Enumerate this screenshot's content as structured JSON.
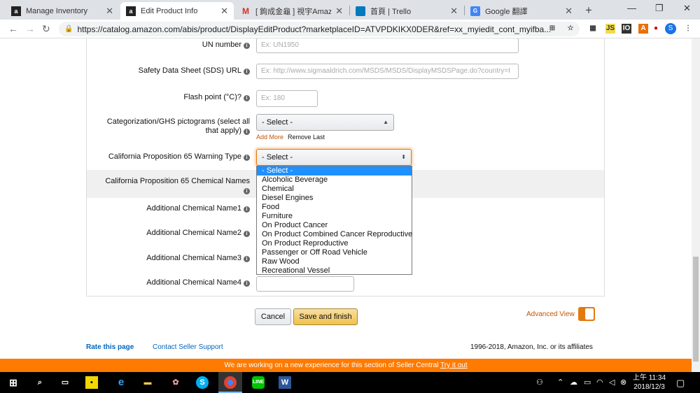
{
  "browser": {
    "tabs": [
      {
        "label": "Manage Inventory",
        "icon": "amazon-icon",
        "active": false
      },
      {
        "label": "Edit Product Info",
        "icon": "amazon-icon",
        "active": true
      },
      {
        "label": "[ 鉤成金龜 ] 視宇Amazon",
        "icon": "gmail-icon",
        "active": false
      },
      {
        "label": "首頁 | Trello",
        "icon": "trello-icon",
        "active": false
      },
      {
        "label": "Google 翻譯",
        "icon": "google-translate-icon",
        "active": false
      }
    ],
    "close_glyph": "✕",
    "new_tab": "+",
    "url": "https://catalog.amazon.com/abis/product/DisplayEditProduct?marketplaceID=ATVPDKIKX0DER&ref=xx_myiedit_cont_myifba...",
    "profile_initial": "S",
    "extensions": [
      "JS",
      "IO"
    ]
  },
  "form": {
    "un_number": {
      "label": "UN number",
      "placeholder": "Ex: UN1950"
    },
    "sds_url": {
      "label": "Safety Data Sheet (SDS) URL",
      "placeholder": "Ex: http://www.sigmaaldrich.com/MSDS/MSDS/DisplayMSDSPage.do?country=I"
    },
    "flash_point": {
      "label": "Flash point (°C)?",
      "placeholder": "Ex: 180"
    },
    "ghs": {
      "label_line1": "Categorization/GHS pictograms (select all",
      "label_line2": "that apply)",
      "value": "- Select -",
      "add_more": "Add More",
      "remove_last": "Remove Last"
    },
    "prop65_type": {
      "label": "California Proposition 65 Warning Type",
      "value": "- Select -"
    },
    "prop65_chem": {
      "label": "California Proposition 65 Chemical Names"
    },
    "additional": [
      {
        "label": "Additional Chemical Name1"
      },
      {
        "label": "Additional Chemical Name2"
      },
      {
        "label": "Additional Chemical Name3"
      },
      {
        "label": "Additional Chemical Name4"
      }
    ],
    "info_glyph": "i"
  },
  "dropdown": {
    "options": [
      "- Select -",
      "Alcoholic Beverage",
      "Chemical",
      "Diesel Engines",
      "Food",
      "Furniture",
      "On Product Cancer",
      "On Product Combined Cancer Reproductive",
      "On Product Reproductive",
      "Passenger or Off Road Vehicle",
      "Raw Wood",
      "Recreational Vessel"
    ],
    "selected_index": 0
  },
  "actions": {
    "cancel": "Cancel",
    "save": "Save and finish",
    "advanced_view": "Advanced View",
    "advanced_view_on": true
  },
  "footer": {
    "rate": "Rate this page",
    "contact": "Contact Seller Support",
    "copyright": "1996-2018, Amazon, Inc. or its affiliates",
    "banner_text": "We are working on a new experience for this section of Seller Central",
    "banner_link": "Try it out"
  },
  "taskbar": {
    "time": "上午 11:34",
    "date": "2018/12/3"
  },
  "colors": {
    "accent_orange": "#ff7a00",
    "link_blue": "#0066c0",
    "select_blue": "#1e90ff",
    "save_yellow": "#f0c14b"
  }
}
